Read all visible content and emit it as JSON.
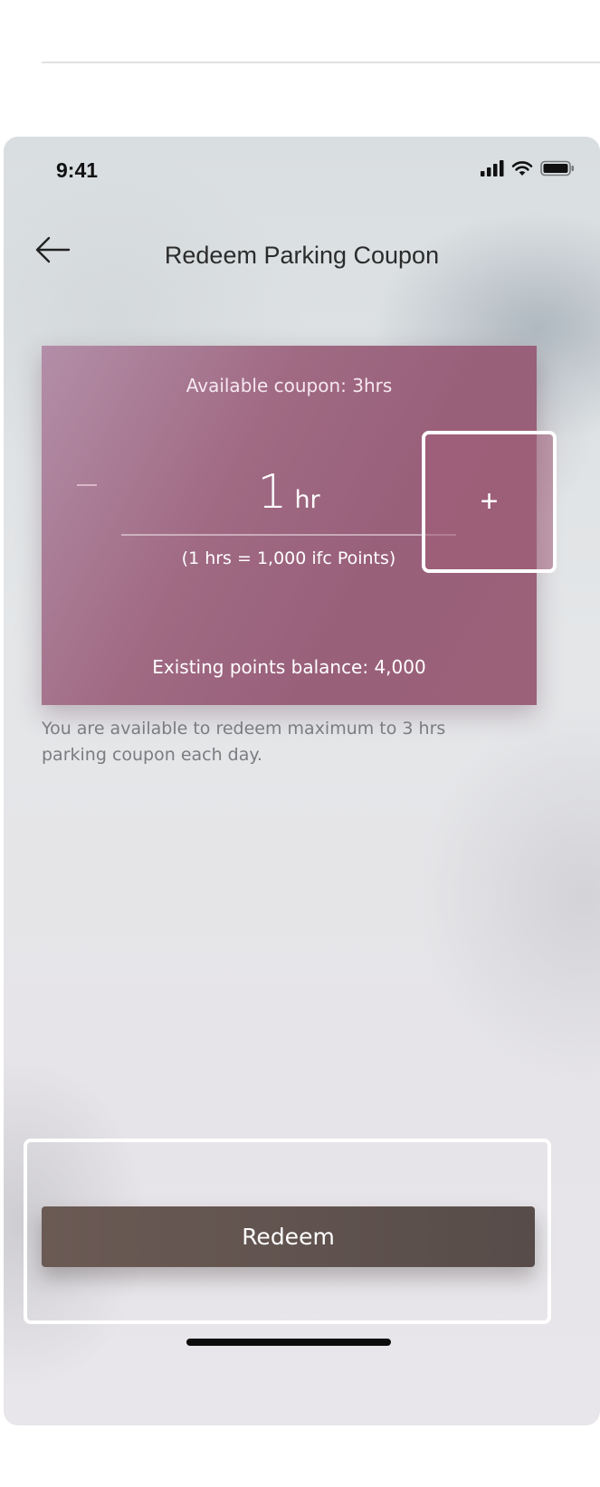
{
  "status_bar": {
    "time": "9:41"
  },
  "header": {
    "title": "Redeem Parking Coupon"
  },
  "coupon": {
    "available": "Available coupon: 3hrs",
    "quantity": "1",
    "unit": "hr",
    "rate": "(1 hrs = 1,000 ifc Points)",
    "balance": "Existing points balance: 4,000",
    "minus_label": "–",
    "plus_label": "+"
  },
  "note": "You are available to redeem maximum to 3 hrs parking coupon each day.",
  "footer": {
    "redeem_label": "Redeem"
  },
  "colors": {
    "card": "#9a6178",
    "button": "#5f524e",
    "highlight_border": "#ffffff"
  }
}
